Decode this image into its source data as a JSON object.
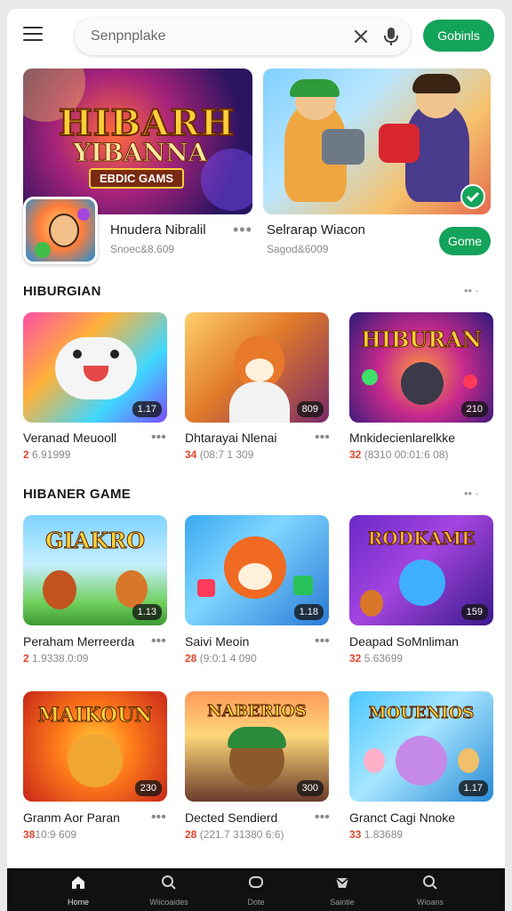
{
  "search": {
    "placeholder": "Senpnplake"
  },
  "header": {
    "action_label": "Gobinls"
  },
  "featured": [
    {
      "art_line1": "HIBARH",
      "art_line2": "YIBANNA",
      "art_line3": "EBDIC GAMS",
      "title": "Hnudera Nibralil",
      "subtitle": "Snoec&8.609"
    },
    {
      "title": "Selrarap Wiacon",
      "subtitle": "Sagod&6009",
      "button": "Gome"
    }
  ],
  "sections": [
    {
      "title": "HIBURGIAN",
      "more": "•• ∙",
      "items": [
        {
          "title": "Veranad Meuooll",
          "meta_prefix": "2",
          "meta_rest": " 6.91999",
          "badge": "1.17",
          "art": ""
        },
        {
          "title": "Dhtarayai Nlenai",
          "meta_prefix": "34",
          "meta_rest": " (08:7 1 309",
          "badge": "809",
          "art": ""
        },
        {
          "title": "Mnkidecienlarelkke",
          "meta_prefix": "32",
          "meta_rest": " (8310 00:01:6 08)",
          "badge": "210",
          "art": "HIBURAN"
        }
      ]
    },
    {
      "title": "HIBANER GAME",
      "more": "•• ∙",
      "items": [
        {
          "title": "Peraham Merreerda",
          "meta_prefix": "2",
          "meta_rest": " 1.9338.0:09",
          "badge": "1.13",
          "art": "GIAKRO"
        },
        {
          "title": "Saivi Meoin",
          "meta_prefix": "28",
          "meta_rest": " (9:0:1 4 090",
          "badge": "1.18",
          "art": ""
        },
        {
          "title": "Deapad SoMnliman",
          "meta_prefix": "32",
          "meta_rest": " 5.63699",
          "badge": "159",
          "art": "RODKAME"
        }
      ]
    },
    {
      "title": "",
      "more": "",
      "items": [
        {
          "title": "Granm Aor Paran",
          "meta_prefix": "38",
          "meta_rest": "10:9 609",
          "badge": "230",
          "art": "MAIKOUN"
        },
        {
          "title": "Dected Sendierd",
          "meta_prefix": "28",
          "meta_rest": " (221.7 31380 6:6)",
          "badge": "300",
          "art": "NABERIOS"
        },
        {
          "title": "Granct Cagi Nnoke",
          "meta_prefix": "33",
          "meta_rest": " 1.83689",
          "badge": "1.17",
          "art": "MOUENIOS"
        }
      ]
    }
  ],
  "nav": [
    {
      "label": "Home",
      "icon": "home-icon",
      "active": true
    },
    {
      "label": "Wiicoaides",
      "icon": "search-icon",
      "active": false
    },
    {
      "label": "Dote",
      "icon": "chat-icon",
      "active": false
    },
    {
      "label": "Saintie",
      "icon": "envelope-icon",
      "active": false
    },
    {
      "label": "Wioans",
      "icon": "search-icon",
      "active": false
    }
  ],
  "colors": {
    "accent": "#14a35a",
    "nav_bg": "#111111",
    "highlight": "#e0452c"
  }
}
